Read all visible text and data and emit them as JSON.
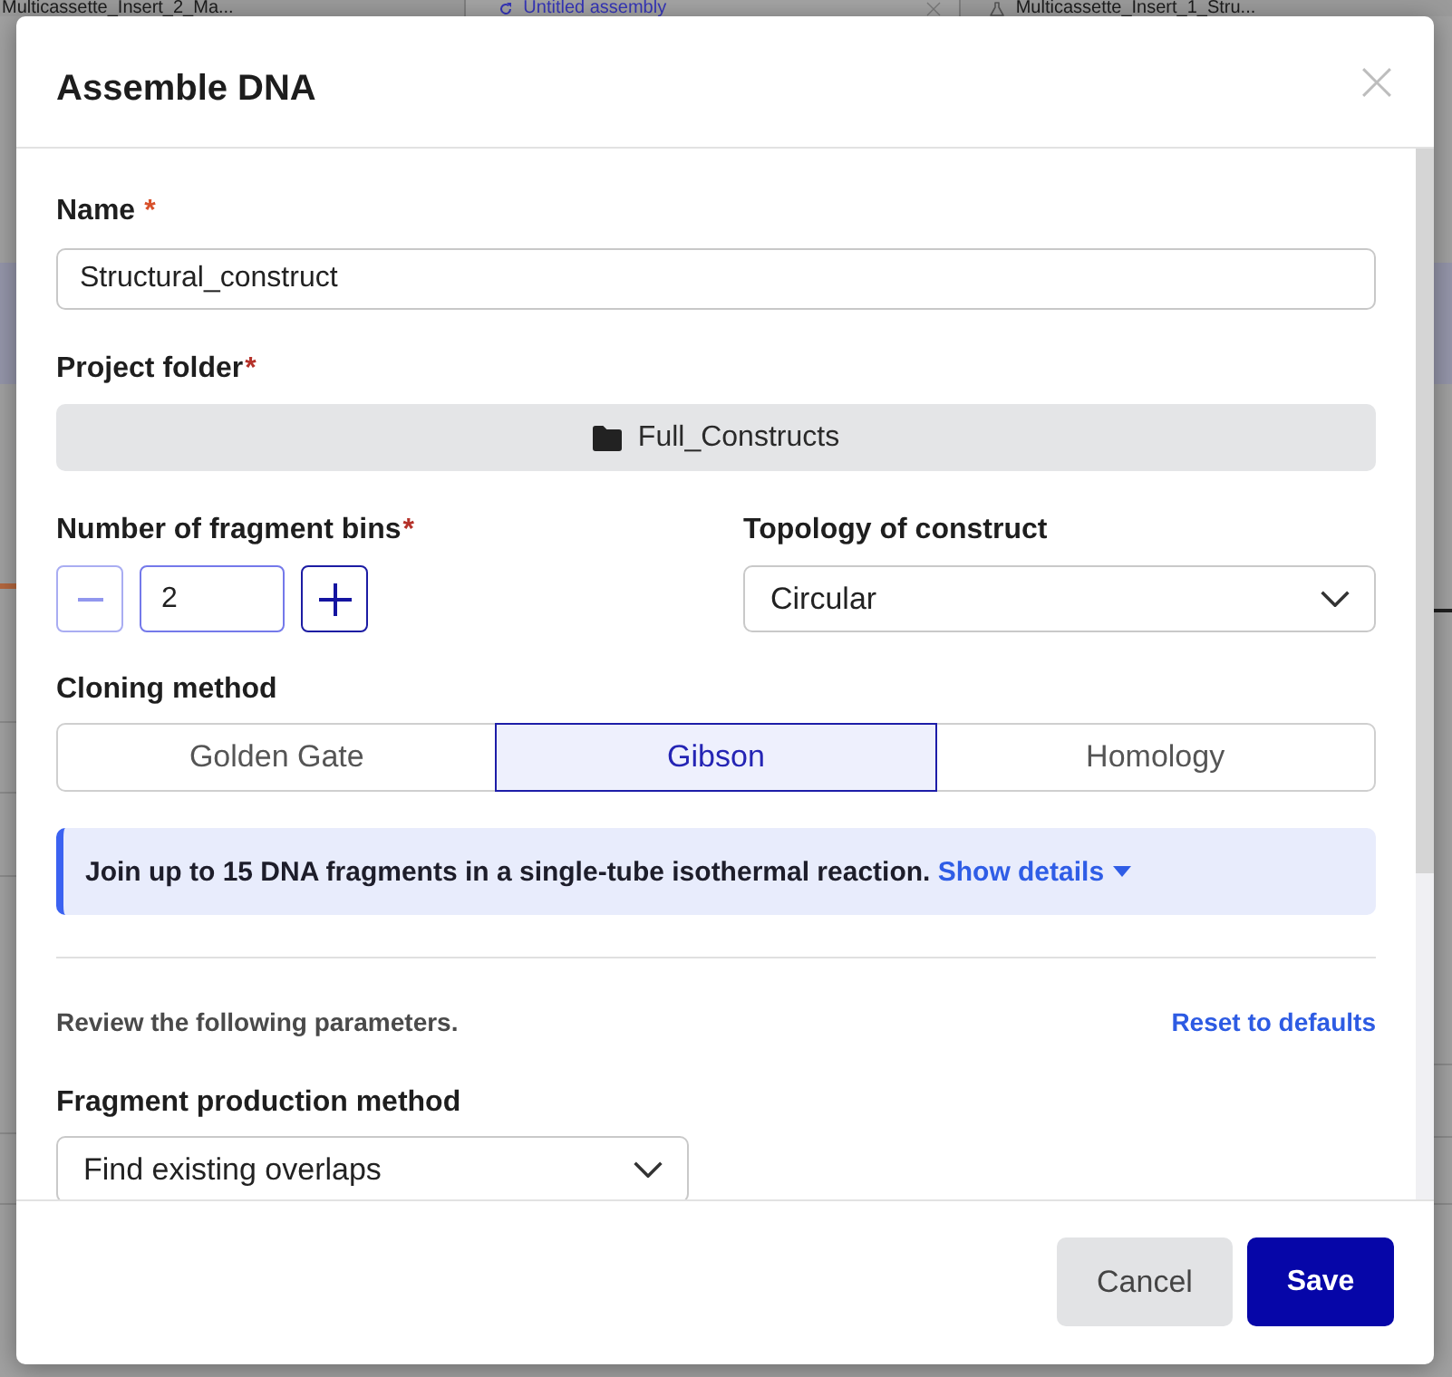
{
  "app_tabs": [
    {
      "label": "Multicassette_Insert_2_Ma...",
      "kind": "plain",
      "selected": false
    },
    {
      "label": "Untitled assembly",
      "kind": "assembly",
      "selected": true
    },
    {
      "label": "Multicassette_Insert_1_Stru...",
      "kind": "construct",
      "selected": false
    }
  ],
  "dialog": {
    "title": "Assemble DNA",
    "name_field": {
      "label": "Name",
      "required_mark": "*",
      "value": "Structural_construct"
    },
    "project_folder": {
      "label": "Project folder",
      "required_mark": "*",
      "value": "Full_Constructs"
    },
    "fragment_bins": {
      "label": "Number of fragment bins",
      "required_mark": "*",
      "value": "2",
      "decrement": {
        "disabled": true
      },
      "increment": {
        "disabled": false
      }
    },
    "topology": {
      "label": "Topology of construct",
      "value": "Circular"
    },
    "cloning_method": {
      "label": "Cloning method",
      "options": [
        {
          "label": "Golden Gate",
          "selected": false
        },
        {
          "label": "Gibson",
          "selected": true
        },
        {
          "label": "Homology",
          "selected": false
        }
      ]
    },
    "info": {
      "text": "Join up to 15 DNA fragments in a single-tube isothermal reaction.",
      "link": "Show details"
    },
    "parameters": {
      "note": "Review the following parameters.",
      "reset_link": "Reset to defaults"
    },
    "fragment_production": {
      "label": "Fragment production method",
      "value": "Find existing overlaps"
    },
    "buttons": [
      {
        "label": "Cancel",
        "kind": "secondary"
      },
      {
        "label": "Save",
        "kind": "primary"
      }
    ]
  }
}
